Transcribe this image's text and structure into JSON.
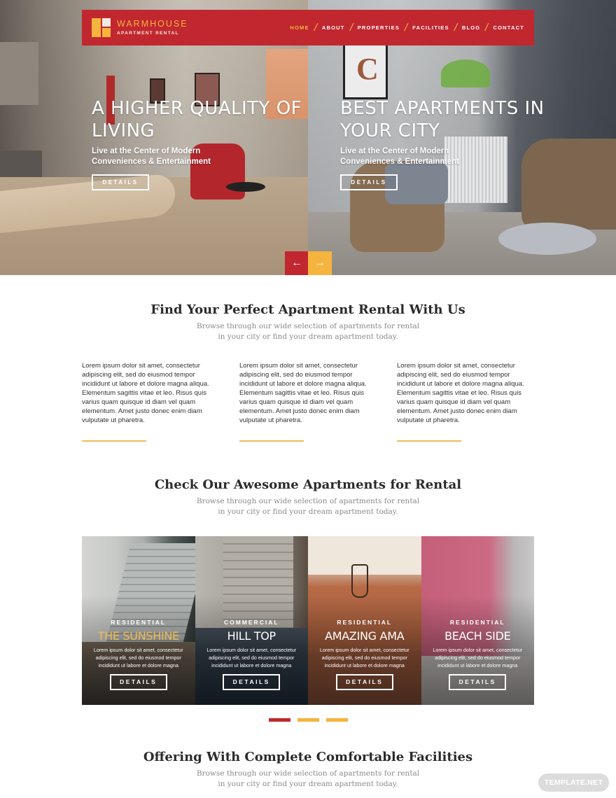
{
  "brand": {
    "name": "WARMHOUSE",
    "tagline": "APARTMENT RENTAL",
    "colors": {
      "primary": "#c1272f",
      "accent": "#f4b43e",
      "text": "#2b2b2b",
      "muted": "#8a8a8a"
    }
  },
  "nav": {
    "items": [
      {
        "label": "HOME",
        "active": true
      },
      {
        "label": "ABOUT",
        "active": false
      },
      {
        "label": "PROPERTIES",
        "active": false
      },
      {
        "label": "FACILITIES",
        "active": false
      },
      {
        "label": "BLOG",
        "active": false
      },
      {
        "label": "CONTACT",
        "active": false
      }
    ],
    "separator": "/"
  },
  "hero": {
    "slides": [
      {
        "heading": "A HIGHER QUALITY OF LIVING",
        "subtitle": "Live at the Center of Modern Conveniences & Entertainment",
        "button": "DETAILS"
      },
      {
        "heading": "BEST APARTMENTS IN YOUR CITY",
        "subtitle": "Live at the Center of Modern Conveniences & Entertainment",
        "button": "DETAILS"
      }
    ],
    "prev_icon": "arrow-left-icon",
    "next_icon": "arrow-right-icon"
  },
  "find_section": {
    "title": "Find Your Perfect Apartment Rental With Us",
    "subtitle": "Browse through our wide selection of apartments for rental in your city or find your dream apartment today.",
    "features": [
      {
        "text": "Lorem ipsum dolor sit amet, consectetur adipiscing elit, sed do eiusmod tempor incididunt ut labore et dolore magna aliqua. Elementum sagittis vitae et leo. Risus quis varius quam quisque id diam vel quam elementum. Amet justo donec enim diam vulputate ut pharetra."
      },
      {
        "text": "Lorem ipsum dolor sit amet, consectetur adipiscing elit, sed do eiusmod tempor incididunt ut labore et dolore magna aliqua. Elementum sagittis vitae et leo. Risus quis varius quam quisque id diam vel quam elementum. Amet justo donec enim diam vulputate ut pharetra."
      },
      {
        "text": "Lorem ipsum dolor sit amet, consectetur adipiscing elit, sed do eiusmod tempor incididunt ut labore et dolore magna aliqua. Elementum sagittis vitae et leo. Risus quis varius quam quisque id diam vel quam elementum. Amet justo donec enim diam vulputate ut pharetra."
      }
    ]
  },
  "apartments_section": {
    "title": "Check Our Awesome Apartments for Rental",
    "subtitle": "Browse through our wide selection of apartments for rental in your city or find your dream apartment today.",
    "cards": [
      {
        "category": "RESIDENTIAL",
        "name": "THE SUNSHINE",
        "description": "Lorem ipsum dolor sit amet, consectetur adipiscing elit, sed do eiusmod tempor incididunt ut labore et dolore magna",
        "button": "DETAILS",
        "active": true
      },
      {
        "category": "COMMERCIAL",
        "name": "HILL TOP",
        "description": "Lorem ipsum dolor sit amet, consectetur adipiscing elit, sed do eiusmod tempor incididunt ut labore et dolore magna",
        "button": "DETAILS",
        "active": false
      },
      {
        "category": "RESIDENTIAL",
        "name": "AMAZING AMA",
        "description": "Lorem ipsum dolor sit amet, consectetur adipiscing elit, sed do eiusmod tempor incididunt ut labore et dolore magna",
        "button": "DETAILS",
        "active": false
      },
      {
        "category": "RESIDENTIAL",
        "name": "BEACH SIDE",
        "description": "Lorem ipsum dolor sit amet, consectetur adipiscing elit, sed do eiusmod tempor incididunt ut labore et dolore magna",
        "button": "DETAILS",
        "active": false
      }
    ],
    "pagination": {
      "total": 3,
      "current": 1
    }
  },
  "facilities_section": {
    "title": "Offering With Complete Comfortable Facilities",
    "subtitle": "Browse through our wide selection of apartments for rental in your city or find your dream apartment today."
  },
  "watermark": "TEMPLATE.NET"
}
